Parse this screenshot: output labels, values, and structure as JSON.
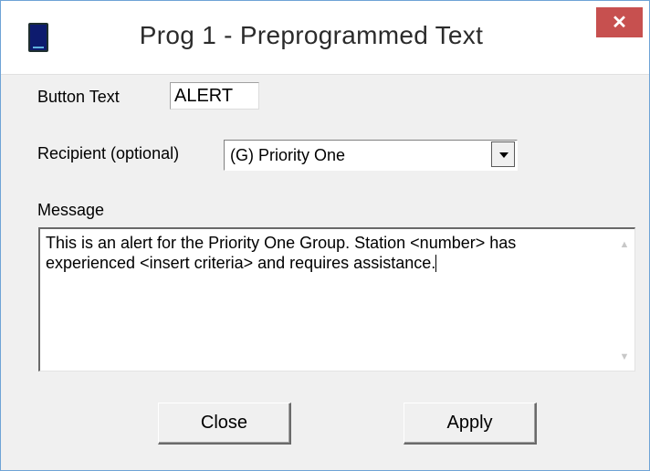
{
  "window": {
    "title": "Prog 1 - Preprogrammed Text",
    "close_glyph": "✕"
  },
  "form": {
    "button_text_label": "Button Text",
    "button_text_value": "ALERT",
    "recipient_label": "Recipient (optional)",
    "recipient_value": "(G) Priority One",
    "message_label": "Message",
    "message_value": "This is an alert for the Priority One Group. Station <number> has experienced <insert criteria> and requires assistance."
  },
  "buttons": {
    "close_label": "Close",
    "apply_label": "Apply"
  },
  "icons": {
    "app": "radio-device-icon",
    "close": "close-icon",
    "dropdown": "chevron-down-icon",
    "scroll_up": "scroll-up-arrow-icon",
    "scroll_down": "scroll-down-arrow-icon"
  },
  "colors": {
    "title_close_bg": "#c7504f",
    "window_border": "#6fa3d6",
    "dialog_bg": "#f0f0f0"
  }
}
